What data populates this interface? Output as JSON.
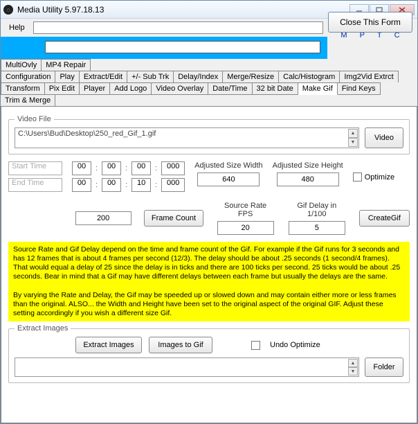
{
  "title": "Media Utility 5.97.18.13",
  "help_label": "Help",
  "close_form": "Close This Form",
  "mptc": [
    "M",
    "P",
    "T",
    "C"
  ],
  "tabs_row1": [
    "MultiOvly",
    "MP4 Repair"
  ],
  "tabs_row2": [
    "Configuration",
    "Play",
    "Extract/Edit",
    "+/- Sub Trk",
    "Delay/Index",
    "Merge/Resize",
    "Calc/Histogram",
    "Img2Vid Extrct"
  ],
  "tabs_row3": [
    "Transform",
    "Pix Edit",
    "Player",
    "Add Logo",
    "Video Overlay",
    "Date/Time",
    "32 bit Date",
    "Make Gif",
    "Find Keys",
    "Trim & Merge"
  ],
  "selected_tab": "Make Gif",
  "video_file": {
    "legend": "Video File",
    "path": "C:\\Users\\Bud\\Desktop\\250_red_Gif_1.gif",
    "button": "Video"
  },
  "start_time_ph": "Start Time",
  "end_time_ph": "End Time",
  "time1": {
    "h": "00",
    "m": "00",
    "s": "00",
    "ms": "000"
  },
  "time2": {
    "h": "00",
    "m": "00",
    "s": "10",
    "ms": "000"
  },
  "adj_width_label": "Adjusted Size Width",
  "adj_height_label": "Adjusted Size Height",
  "adj_width": "640",
  "adj_height": "480",
  "optimize_label": "Optimize",
  "frame_count_value": "200",
  "frame_count_btn": "Frame Count",
  "source_rate_label": "Source Rate FPS",
  "source_rate": "20",
  "gif_delay_label": "Gif Delay in 1/100",
  "gif_delay": "5",
  "create_gif_btn": "CreateGif",
  "note_p1": "Source Rate and Gif Delay depend on the time and frame count of the Gif.  For example if the Gif runs for 3 seconds and has 12 frames that is about 4 frames per second (12/3).  The delay should be about .25 seconds (1 second/4 frames).  That would equal a delay of 25 since the delay is in ticks and there are 100 ticks per second.  25 ticks would be about .25 seconds.  Bear in mind that a Gif may have different delays between each frame but usually the delays are the same.",
  "note_p2": "By varying the Rate and Delay, the Gif may be speeded up or slowed down and may contain either more or less frames than the original.  ALSO... the Width and Height have been set to the original aspect of the original GIF.  Adjust these setting accordingly if you wish a different size Gif.",
  "extract": {
    "legend": "Extract Images",
    "extract_btn": "Extract Images",
    "images_to_gif_btn": "Images to Gif",
    "undo_optimize_label": "Undo Optimize",
    "folder_btn": "Folder"
  }
}
